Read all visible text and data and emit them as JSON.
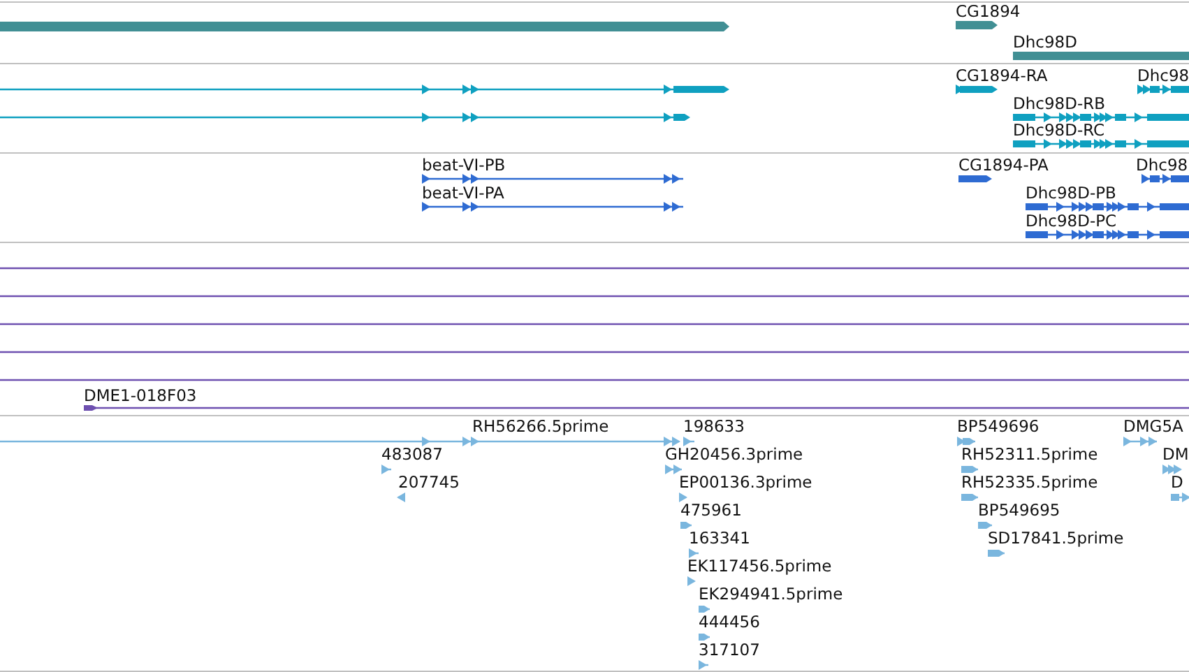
{
  "tracks": [
    {
      "kind": "gene",
      "features": [
        {
          "label": "CG1894"
        },
        {
          "label": "Dhc98D"
        }
      ]
    },
    {
      "kind": "transcript",
      "features": [
        {
          "label": "CG1894-RA"
        },
        {
          "label": "Dhc98"
        },
        {
          "label": "Dhc98D-RB"
        },
        {
          "label": "Dhc98D-RC"
        }
      ]
    },
    {
      "kind": "protein",
      "features": [
        {
          "label": "beat-VI-PB"
        },
        {
          "label": "beat-VI-PA"
        },
        {
          "label": "CG1894-PA"
        },
        {
          "label": "Dhc98"
        },
        {
          "label": "Dhc98D-PB"
        },
        {
          "label": "Dhc98D-PC"
        }
      ]
    },
    {
      "kind": "clone",
      "features": [
        {
          "label": "DME1-018F03"
        }
      ]
    },
    {
      "kind": "est",
      "features": [
        {
          "label": "RH56266.5prime"
        },
        {
          "label": "198633"
        },
        {
          "label": "483087"
        },
        {
          "label": "207745"
        },
        {
          "label": "GH20456.3prime"
        },
        {
          "label": "EP00136.3prime"
        },
        {
          "label": "475961"
        },
        {
          "label": "163341"
        },
        {
          "label": "EK117456.5prime"
        },
        {
          "label": "EK294941.5prime"
        },
        {
          "label": "444456"
        },
        {
          "label": "317107"
        },
        {
          "label": "BP549696"
        },
        {
          "label": "RH52311.5prime"
        },
        {
          "label": "RH52335.5prime"
        },
        {
          "label": "BP549695"
        },
        {
          "label": "SD17841.5prime"
        },
        {
          "label": "DMG5A"
        },
        {
          "label": "DM"
        },
        {
          "label": "D"
        }
      ]
    }
  ]
}
